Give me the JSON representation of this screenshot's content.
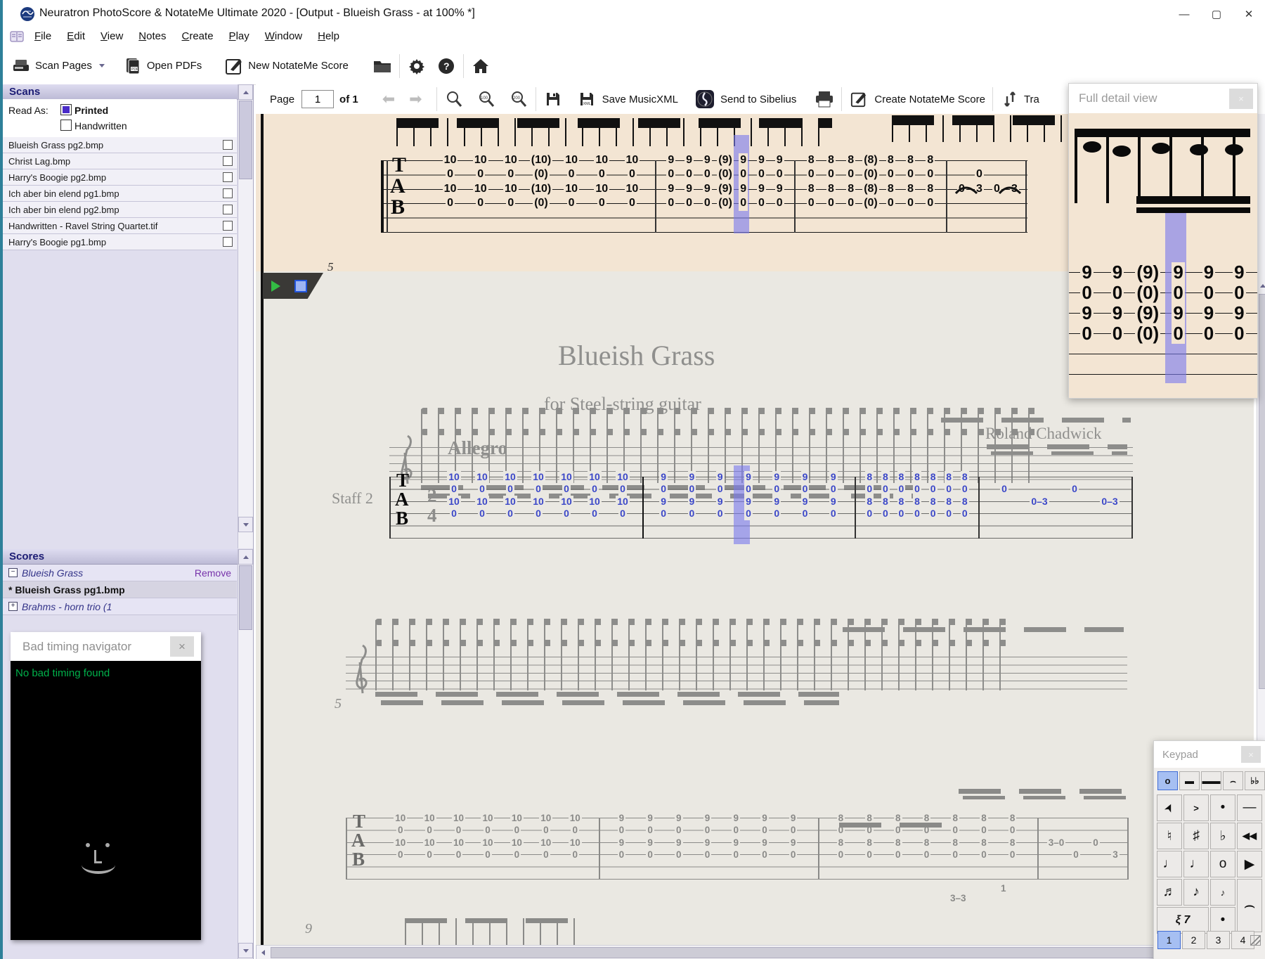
{
  "window": {
    "title": "Neuratron PhotoScore & NotateMe Ultimate 2020 - [Output - Blueish Grass - at 100% *]",
    "minimize": "—",
    "maximize": "▢",
    "close": "✕",
    "mdi_minimize": "—",
    "mdi_restore": "❐",
    "mdi_close": "✕"
  },
  "menus": [
    "File",
    "Edit",
    "View",
    "Notes",
    "Create",
    "Play",
    "Window",
    "Help"
  ],
  "toolbar1": {
    "scan_pages": "Scan Pages",
    "open_pdfs": "Open PDFs",
    "new_notateme": "New NotateMe Score"
  },
  "toolbar2": {
    "page_label": "Page",
    "page_value": "1",
    "of_label": "of 1",
    "save_musicxml": "Save MusicXML",
    "send_to_sibelius": "Send to Sibelius",
    "create_notateme": "Create NotateMe Score",
    "transpose_label": "Tra"
  },
  "icons": [
    "scanner-icon",
    "pdf-icon",
    "pencil-square-icon",
    "folder-icon",
    "gear-icon",
    "help-icon",
    "home-icon",
    "back-arrow-icon",
    "forward-arrow-icon",
    "zoom-icon",
    "zoom-100-icon",
    "zoom-200-icon",
    "floppy-icon",
    "floppy-xml-icon",
    "sibelius-icon",
    "printer-icon",
    "transpose-icon",
    "play-icon",
    "stop-icon",
    "smiley-icon"
  ],
  "scans": {
    "header": "Scans",
    "read_as": "Read As:",
    "printed": "Printed",
    "handwritten": "Handwritten",
    "files": [
      "Blueish Grass pg2.bmp",
      "Christ Lag.bmp",
      "Harry's Boogie pg2.bmp",
      "Ich aber bin elend pg1.bmp",
      "Ich aber bin elend pg2.bmp",
      "Handwritten - Ravel String Quartet.tif",
      "Harry's Boogie pg1.bmp"
    ]
  },
  "scores": {
    "header": "Scores",
    "item1": "Blueish Grass",
    "item1_action": "Remove",
    "item2": "* Blueish Grass pg1.bmp",
    "item3": "Brahms - horn trio (1"
  },
  "bad_timing": {
    "title": "Bad timing navigator",
    "message": "No bad timing found"
  },
  "detail_view": {
    "title": "Full detail view",
    "cols": [
      [
        "9",
        "0",
        "9",
        "0"
      ],
      [
        "9",
        "0",
        "9",
        "0"
      ],
      [
        "(9)",
        "(0)",
        "(9)",
        "(0)"
      ],
      [
        "9",
        "0",
        "9",
        "0"
      ],
      [
        "9",
        "0",
        "9",
        "0"
      ],
      [
        "9",
        "0",
        "9",
        "0"
      ]
    ]
  },
  "keypad": {
    "title": "Keypad",
    "tools": [
      {
        "g": "o",
        "cls": "sel",
        "name": "whole-note"
      },
      {
        "g": "▬",
        "cls": "",
        "name": "note-bar"
      },
      {
        "g": "▬▬",
        "cls": "",
        "name": "beam-bar"
      },
      {
        "g": "⌢",
        "cls": "",
        "name": "fermata"
      },
      {
        "g": "♭♭",
        "cls": "",
        "name": "double-flat"
      }
    ],
    "grid": [
      {
        "g": "➤",
        "cls": "cursor",
        "name": "pointer"
      },
      {
        "g": ">",
        "cls": "small",
        "name": "accent"
      },
      {
        "g": "•",
        "cls": "",
        "name": "staccato"
      },
      {
        "g": "—",
        "cls": "",
        "name": "tenuto"
      },
      {
        "g": "♮",
        "cls": "",
        "name": "natural"
      },
      {
        "g": "♯",
        "cls": "",
        "name": "sharp"
      },
      {
        "g": "♭",
        "cls": "",
        "name": "flat"
      },
      {
        "g": "◀◀",
        "cls": "small",
        "name": "rewind"
      },
      {
        "g": "♩",
        "cls": "",
        "name": "quarter-note"
      },
      {
        "g": "♩",
        "cls": "",
        "name": "half-note"
      },
      {
        "g": "o",
        "cls": "",
        "name": "whole-note"
      },
      {
        "g": "▶",
        "cls": "",
        "name": "play"
      },
      {
        "g": "♬",
        "cls": "",
        "name": "sixteenth-note"
      },
      {
        "g": "♪",
        "cls": "",
        "name": "eighth-note"
      },
      {
        "g": "♪",
        "cls": "small",
        "name": "grace-note"
      },
      {
        "g": "⌢",
        "cls": "h2 tie",
        "name": "tie"
      },
      {
        "g": "ξ 7",
        "cls": "w2 rests",
        "name": "rests"
      },
      {
        "g": "•",
        "cls": "",
        "name": "dot"
      }
    ],
    "tabs": [
      {
        "g": "1",
        "cls": "sel",
        "name": "tab-1"
      },
      {
        "g": "2",
        "cls": "",
        "name": "tab-2"
      },
      {
        "g": "3",
        "cls": "",
        "name": "tab-3"
      },
      {
        "g": "4",
        "cls": "",
        "name": "tab-4"
      }
    ]
  },
  "score": {
    "title": "Blueish Grass",
    "subtitle": "for Steel-string guitar",
    "composer": "Roland Chadwick",
    "tempo": "Allegro",
    "staff_label": "Staff 2",
    "tab_t": "T",
    "tab_a": "A",
    "tab_b": "B",
    "time_sig_top": "2",
    "time_sig_bottom": "4",
    "measure_number_5": "5",
    "measure_number_9": "9",
    "sys2_below_1": "1",
    "sys2_below_33": "3–3",
    "scan": {
      "m1": [
        [
          "10",
          "0",
          "10",
          "0"
        ],
        [
          "10",
          "0",
          "10",
          "0"
        ],
        [
          "10",
          "0",
          "10",
          "0"
        ],
        [
          "(10)",
          "(0)",
          "(10)",
          "(0)"
        ],
        [
          "10",
          "0",
          "10",
          "0"
        ],
        [
          "10",
          "0",
          "10",
          "0"
        ],
        [
          "10",
          "0",
          "10",
          "0"
        ]
      ],
      "m2": [
        [
          "9",
          "0",
          "9",
          "0"
        ],
        [
          "9",
          "0",
          "9",
          "0"
        ],
        [
          "9",
          "0",
          "9",
          "0"
        ],
        [
          "(9)",
          "(0)",
          "(9)",
          "(0)"
        ],
        [
          "9",
          "0",
          "9",
          "0"
        ],
        [
          "9",
          "0",
          "9",
          "0"
        ],
        [
          "9",
          "0",
          "9",
          "0"
        ]
      ],
      "m3": [
        [
          "8",
          "0",
          "8",
          "0"
        ],
        [
          "8",
          "0",
          "8",
          "0"
        ],
        [
          "8",
          "0",
          "8",
          "0"
        ],
        [
          "(8)",
          "(0)",
          "(8)",
          "(0)"
        ],
        [
          "8",
          "0",
          "8",
          "0"
        ],
        [
          "8",
          "0",
          "8",
          "0"
        ],
        [
          "8",
          "0",
          "8",
          "0"
        ]
      ],
      "m4": [
        [
          "",
          "",
          "0",
          ""
        ],
        [
          "",
          "0",
          "3",
          ""
        ],
        [
          "",
          "",
          "0",
          ""
        ],
        [
          "",
          "",
          "3",
          ""
        ]
      ]
    },
    "system1": {
      "m1": [
        [
          "10",
          "0",
          "10",
          "0"
        ],
        [
          "10",
          "0",
          "10",
          "0"
        ],
        [
          "10",
          "0",
          "10",
          "0"
        ],
        [
          "10",
          "0",
          "10",
          "0"
        ],
        [
          "10",
          "0",
          "10",
          "0"
        ],
        [
          "10",
          "0",
          "10",
          "0"
        ],
        [
          "10",
          "0",
          "10",
          "0"
        ]
      ],
      "m2": [
        [
          "9",
          "0",
          "9",
          "0"
        ],
        [
          "9",
          "0",
          "9",
          "0"
        ],
        [
          "9",
          "0",
          "9",
          "0"
        ],
        [
          "9",
          "0",
          "9",
          "0"
        ],
        [
          "9",
          "0",
          "9",
          "0"
        ],
        [
          "9",
          "0",
          "9",
          "0"
        ],
        [
          "9",
          "0",
          "9",
          "0"
        ]
      ],
      "m3": [
        [
          "8",
          "0",
          "8",
          "0"
        ],
        [
          "8",
          "0",
          "8",
          "0"
        ],
        [
          "8",
          "0",
          "8",
          "0"
        ],
        [
          "8",
          "0",
          "8",
          "0"
        ],
        [
          "8",
          "0",
          "8",
          "0"
        ],
        [
          "8",
          "0",
          "8",
          "0"
        ],
        [
          "8",
          "0",
          "8",
          "0"
        ]
      ],
      "m4": [
        [
          "",
          "0",
          "",
          ""
        ],
        [
          "",
          "",
          "0–3",
          ""
        ],
        [
          "",
          "0",
          "",
          ""
        ],
        [
          "",
          "",
          "0–3",
          ""
        ]
      ]
    },
    "system2": {
      "m1": [
        [
          "10",
          "0",
          "10",
          "0"
        ],
        [
          "10",
          "0",
          "10",
          "0"
        ],
        [
          "10",
          "0",
          "10",
          "0"
        ],
        [
          "10",
          "0",
          "10",
          "0"
        ],
        [
          "10",
          "0",
          "10",
          "0"
        ],
        [
          "10",
          "0",
          "10",
          "0"
        ],
        [
          "10",
          "0",
          "10",
          "0"
        ]
      ],
      "m2": [
        [
          "9",
          "0",
          "9",
          "0"
        ],
        [
          "9",
          "0",
          "9",
          "0"
        ],
        [
          "9",
          "0",
          "9",
          "0"
        ],
        [
          "9",
          "0",
          "9",
          "0"
        ],
        [
          "9",
          "0",
          "9",
          "0"
        ],
        [
          "9",
          "0",
          "9",
          "0"
        ],
        [
          "9",
          "0",
          "9",
          "0"
        ]
      ],
      "m3": [
        [
          "8",
          "0",
          "8",
          "0"
        ],
        [
          "8",
          "0",
          "8",
          "0"
        ],
        [
          "8",
          "0",
          "8",
          "0"
        ],
        [
          "8",
          "0",
          "8",
          "0"
        ],
        [
          "8",
          "0",
          "8",
          "0"
        ],
        [
          "8",
          "0",
          "8",
          "0"
        ],
        [
          "8",
          "0",
          "8",
          "0"
        ]
      ],
      "m4": [
        [
          "",
          "",
          "3–0",
          ""
        ],
        [
          "",
          "",
          "",
          "0"
        ],
        [
          "",
          "",
          "0",
          ""
        ],
        [
          "",
          "",
          "",
          "3"
        ]
      ]
    }
  }
}
